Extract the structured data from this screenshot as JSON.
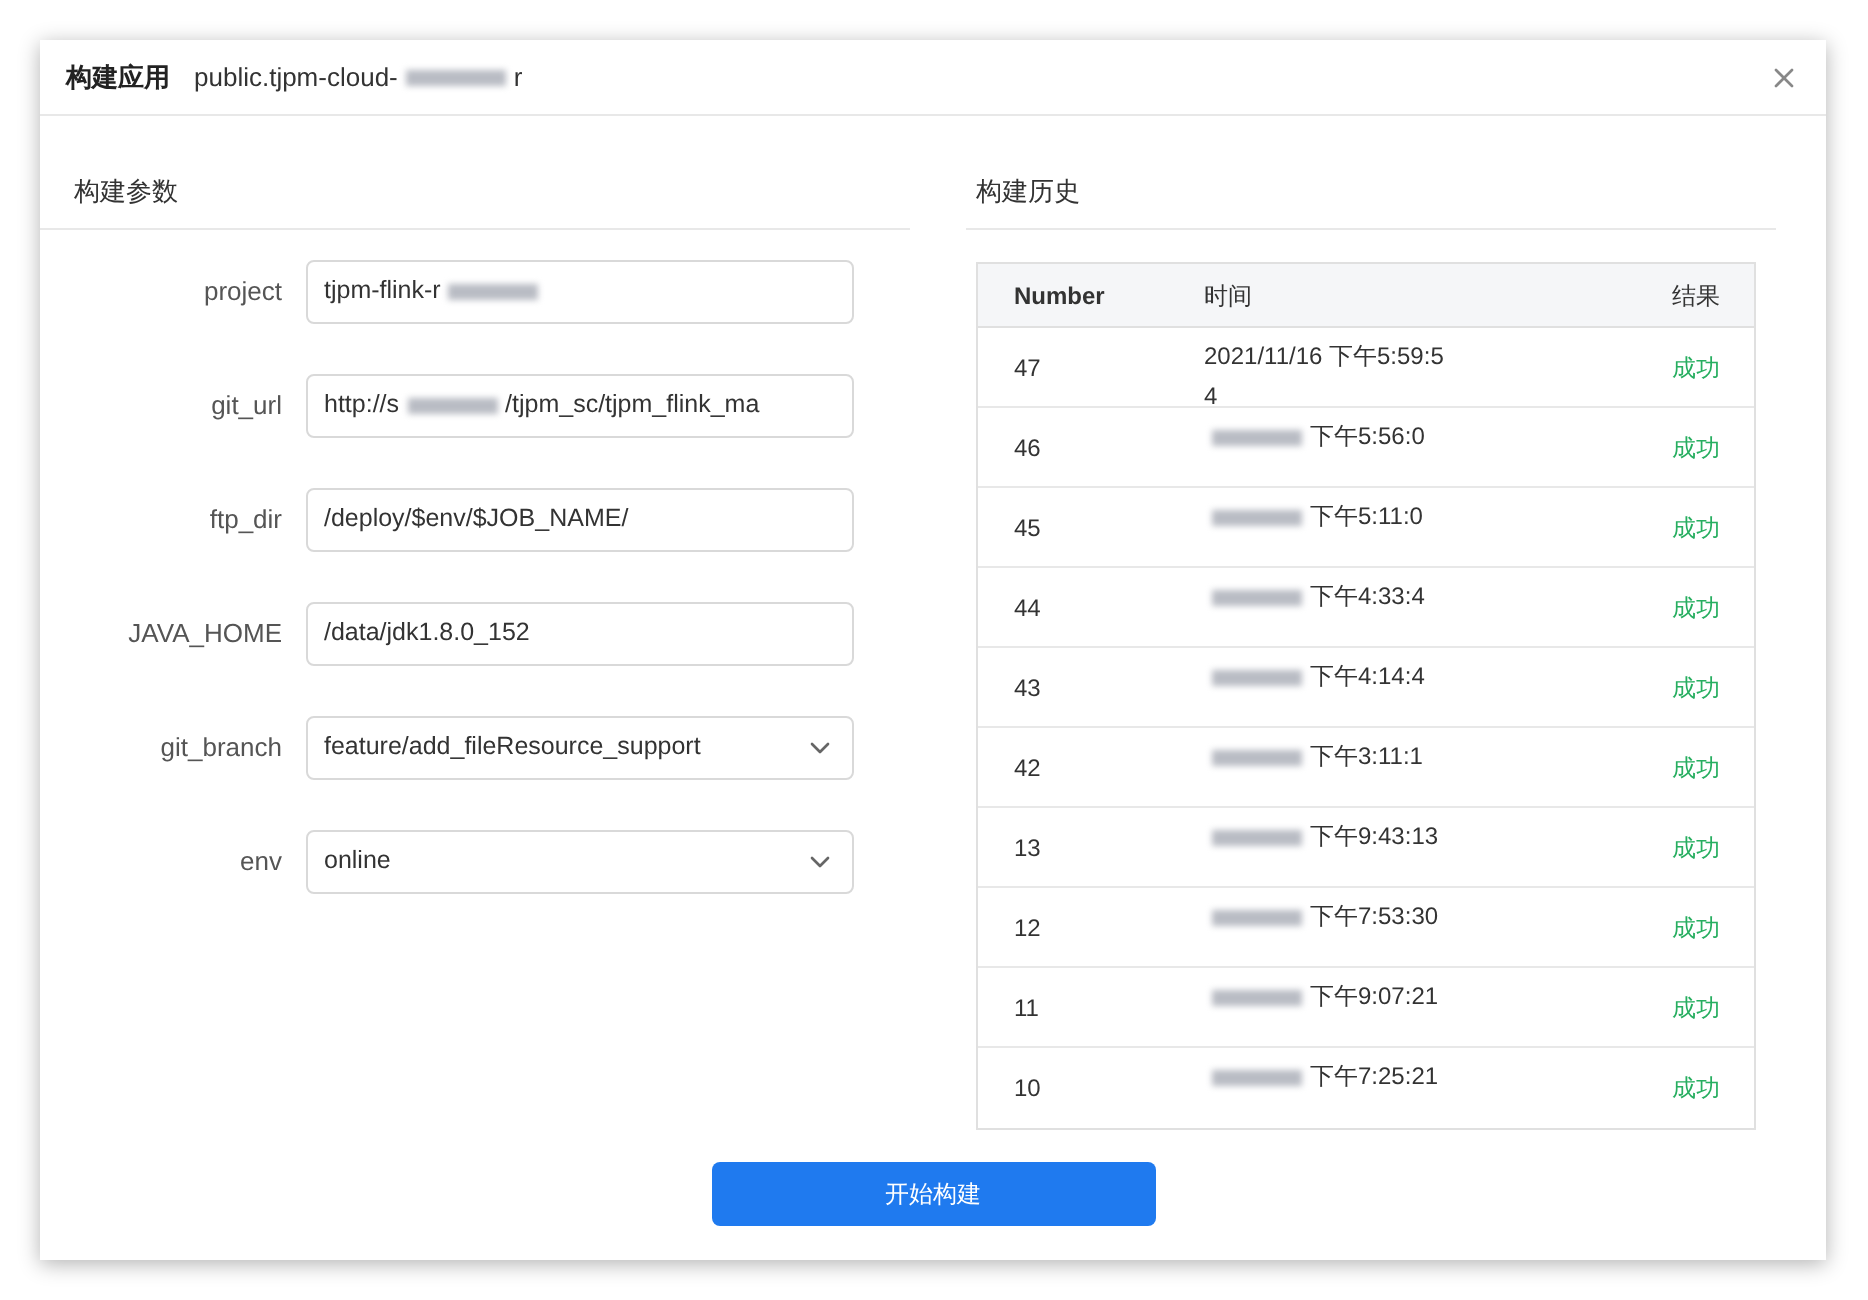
{
  "dialog": {
    "title": "构建应用",
    "subtitle": "public.tjpm-cloud-",
    "subtitle_redacted": true,
    "subtitle_tail": "r"
  },
  "params": {
    "title": "构建参数",
    "fields": [
      {
        "kind": "input",
        "label": "project",
        "value": "tjpm-flink-r",
        "redacted": true
      },
      {
        "kind": "input",
        "label": "git_url",
        "value": "http://s",
        "redacted": true,
        "tail": "/tjpm_sc/tjpm_flink_ma"
      },
      {
        "kind": "input",
        "label": "ftp_dir",
        "value": "/deploy/$env/$JOB_NAME/",
        "redacted": false
      },
      {
        "kind": "input",
        "label": "JAVA_HOME",
        "value": "/data/jdk1.8.0_152",
        "redacted": false
      },
      {
        "kind": "select",
        "label": "git_branch",
        "value": "feature/add_fileResource_support",
        "redacted": false
      },
      {
        "kind": "select",
        "label": "env",
        "value": "online",
        "redacted": false
      }
    ]
  },
  "history": {
    "title": "构建历史",
    "columns": [
      "Number",
      "时间",
      "结果"
    ],
    "rows": [
      {
        "number": "47",
        "time": "2021/11/16 下午5:59:54",
        "redacted": false,
        "result": "成功"
      },
      {
        "number": "46",
        "time": "下午5:56:0",
        "redacted": true,
        "result": "成功"
      },
      {
        "number": "45",
        "time": "下午5:11:0",
        "redacted": true,
        "result": "成功"
      },
      {
        "number": "44",
        "time": "下午4:33:4",
        "redacted": true,
        "result": "成功"
      },
      {
        "number": "43",
        "time": "下午4:14:4",
        "redacted": true,
        "result": "成功"
      },
      {
        "number": "42",
        "time": "下午3:11:1",
        "redacted": true,
        "result": "成功"
      },
      {
        "number": "13",
        "time": "下午9:43:13",
        "redacted": true,
        "result": "成功"
      },
      {
        "number": "12",
        "time": "下午7:53:30",
        "redacted": true,
        "result": "成功"
      },
      {
        "number": "11",
        "time": "下午9:07:21",
        "redacted": true,
        "result": "成功"
      },
      {
        "number": "10",
        "time": "下午7:25:21",
        "redacted": true,
        "result": "成功"
      }
    ]
  },
  "submit": "开始构建"
}
